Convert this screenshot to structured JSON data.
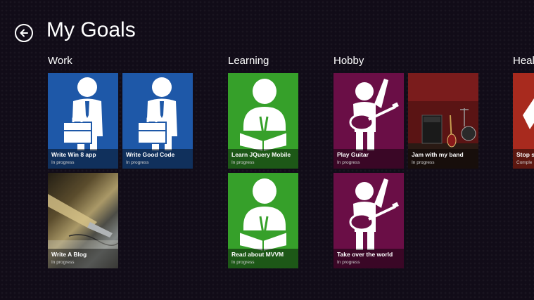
{
  "page": {
    "title": "My Goals",
    "back_icon": "back-arrow-icon"
  },
  "colors": {
    "work": "#1e58a8",
    "learning": "#36a02a",
    "hobby": "#6a0e46",
    "health": "#a82a1e"
  },
  "groups": [
    {
      "name": "Work",
      "tiles": [
        {
          "title": "Write Win 8 app",
          "status": "In progress"
        },
        {
          "title": "Write Good Code",
          "status": "In progress"
        },
        {
          "title": "Write A Blog",
          "status": "In progress"
        }
      ]
    },
    {
      "name": "Learning",
      "tiles": [
        {
          "title": "Learn JQuery Mobile",
          "status": "In progress"
        },
        {
          "title": "Read about MVVM",
          "status": "In progress"
        }
      ]
    },
    {
      "name": "Hobby",
      "tiles": [
        {
          "title": "Play Guitar",
          "status": "In progress"
        },
        {
          "title": "Jam with my band",
          "status": "In progress"
        },
        {
          "title": "Take over the world",
          "status": "In progress"
        }
      ]
    },
    {
      "name": "Heal",
      "tiles": [
        {
          "title": "Stop s",
          "status": "Comple"
        }
      ]
    }
  ]
}
